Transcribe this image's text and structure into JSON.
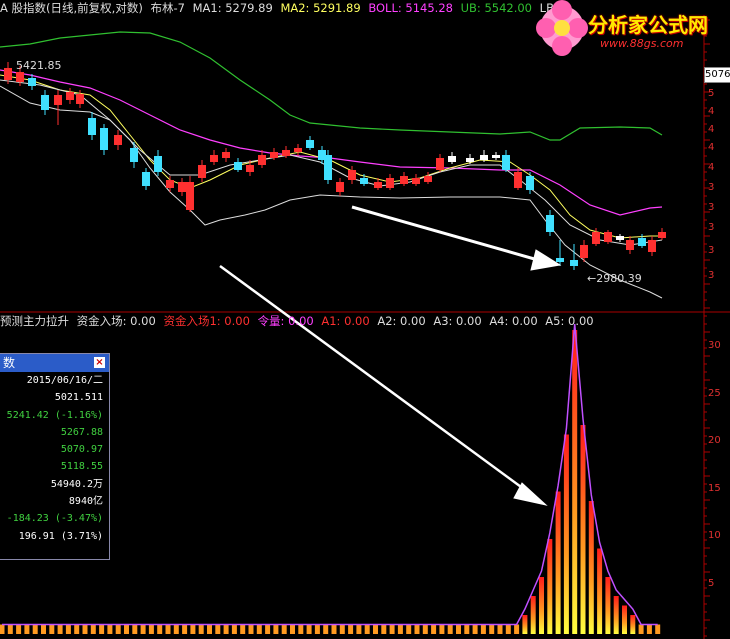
{
  "header": {
    "title": "A 股指数(日线,前复权,对数)",
    "indicator": "布林-7",
    "ma1": "MA1: 5279.89",
    "ma2": "MA2: 5291.89",
    "boll": "BOLL: 5145.28",
    "ub": "UB: 5542.00",
    "lb": "LB: 4"
  },
  "subheader": {
    "name": "预测主力拉升",
    "fund_in": "资金入场: 0.00",
    "fund_in1": "资金入场1: 0.00",
    "volume": "令量: 0.00",
    "a1": "A1: 0.00",
    "a2": "A2: 0.00",
    "a3": "A3: 0.00",
    "a4": "A4: 0.00",
    "a5": "A5: 0.00"
  },
  "price_tag": "5076",
  "labels": {
    "high": "5421.85",
    "low": "2980.39"
  },
  "right_axis_top": [
    "5",
    "4",
    "4",
    "4",
    "4",
    "3",
    "3",
    "3",
    "3",
    "3"
  ],
  "right_axis_bottom": [
    "30",
    "25",
    "20",
    "15",
    "10",
    "5"
  ],
  "panel": {
    "title": "数",
    "rows": [
      {
        "text": "2015/06/16/二",
        "color": "#ffffff"
      },
      {
        "text": "5021.511",
        "color": "#ffffff"
      },
      {
        "text": "5241.42 (-1.16%)",
        "color": "#40d040"
      },
      {
        "text": "5267.88",
        "color": "#40d040"
      },
      {
        "text": "5070.97",
        "color": "#40d040"
      },
      {
        "text": "5118.55",
        "color": "#40d040"
      },
      {
        "text": "54940.2万",
        "color": "#ffffff"
      },
      {
        "text": "8940亿",
        "color": "#ffffff"
      },
      {
        "text": "-184.23 (-3.47%)",
        "color": "#40d040"
      },
      {
        "text": "196.91 (3.71%)",
        "color": "#ffffff"
      }
    ]
  },
  "logo": {
    "text": "分析家公式网",
    "url": "www.88gs.com"
  },
  "colors": {
    "up": "#ff3030",
    "down": "#40e0ff",
    "mid": "#ffffff",
    "ub": "#30c030",
    "ma": "#ff40ff"
  },
  "histogram_values": [
    1,
    1,
    1,
    1,
    1,
    1,
    1,
    1,
    1,
    1,
    1,
    1,
    1,
    1,
    1,
    1,
    1,
    1,
    1,
    1,
    1,
    1,
    1,
    1,
    1,
    1,
    1,
    1,
    1,
    1,
    1,
    1,
    1,
    1,
    1,
    1,
    1,
    1,
    1,
    1,
    1,
    1,
    1,
    1,
    1,
    1,
    1,
    1,
    1,
    1,
    1,
    1,
    1,
    1,
    1,
    1,
    1,
    1,
    1,
    1,
    1,
    1,
    1,
    2,
    4,
    6,
    10,
    15,
    21,
    32,
    22,
    14,
    9,
    6,
    4,
    3,
    2,
    1,
    1,
    1
  ]
}
